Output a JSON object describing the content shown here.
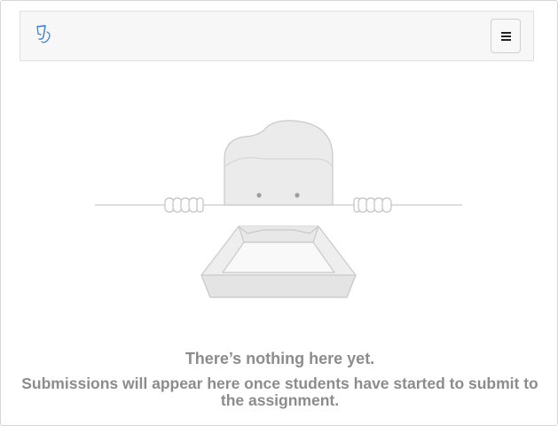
{
  "navbar": {
    "logo_icon": "quill-logo-icon",
    "menu_icon": "hamburger-menu-icon"
  },
  "empty_state": {
    "illustration": "peeking-character-with-empty-tray",
    "title": "There’s nothing here yet.",
    "message": "Submissions will appear here once students have started to submit to the assignment."
  },
  "colors": {
    "navbar_bg": "#f7f7f7",
    "text_muted": "#8c8c8c",
    "logo_blue": "#3a7bc8",
    "illustration_fill": "#ebebeb",
    "illustration_stroke": "#c9c9c9"
  }
}
